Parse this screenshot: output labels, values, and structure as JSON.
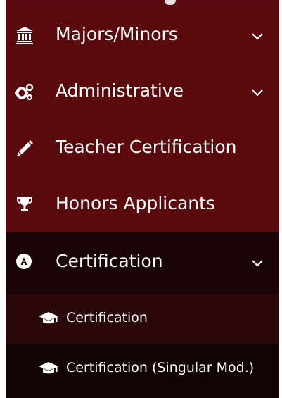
{
  "sidebar": {
    "colors": {
      "primary_bg": "#5a090d",
      "expanded_bg": "#190507",
      "submenu_bg": "#2a0709",
      "submenu_bg_alt": "#120305",
      "text": "#ffffff"
    },
    "items": [
      {
        "label": "Majors/Minors",
        "icon": "university-icon",
        "expandable": true
      },
      {
        "label": "Administrative",
        "icon": "gears-icon",
        "expandable": true
      },
      {
        "label": "Teacher Certification",
        "icon": "pencil-icon",
        "expandable": false
      },
      {
        "label": "Honors Applicants",
        "icon": "trophy-icon",
        "expandable": false
      },
      {
        "label": "Certification",
        "icon": "certificate-circle-icon",
        "expandable": true,
        "expanded": true,
        "children": [
          {
            "label": "Certification",
            "icon": "graduation-cap-icon"
          },
          {
            "label": "Certification (Singular Mod.)",
            "icon": "graduation-cap-icon"
          }
        ]
      }
    ]
  }
}
